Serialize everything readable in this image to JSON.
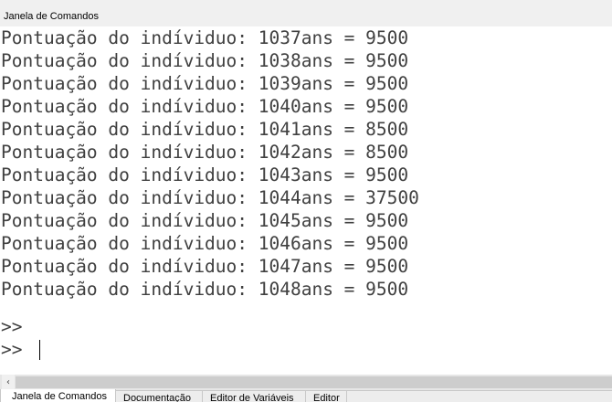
{
  "window": {
    "title": "Janela de Comandos"
  },
  "console": {
    "lines": [
      "Pontuação do indíviduo: 1037ans = 9500",
      "Pontuação do indíviduo: 1038ans = 9500",
      "Pontuação do indíviduo: 1039ans = 9500",
      "Pontuação do indíviduo: 1040ans = 9500",
      "Pontuação do indíviduo: 1041ans = 8500",
      "Pontuação do indíviduo: 1042ans = 8500",
      "Pontuação do indíviduo: 1043ans = 9500",
      "Pontuação do indíviduo: 1044ans = 37500",
      "Pontuação do indíviduo: 1045ans = 9500",
      "Pontuação do indíviduo: 1046ans = 9500",
      "Pontuação do indíviduo: 1047ans = 9500",
      "Pontuação do indíviduo: 1048ans = 9500"
    ],
    "prompts": [
      ">>",
      ">>"
    ]
  },
  "scrollbar": {
    "left_arrow": "‹"
  },
  "tabs": [
    {
      "label": "Janela de Comandos",
      "active": true
    },
    {
      "label": "Documentação",
      "active": false
    },
    {
      "label": "Editor de Variáveis",
      "active": false
    },
    {
      "label": "Editor",
      "active": false
    }
  ]
}
